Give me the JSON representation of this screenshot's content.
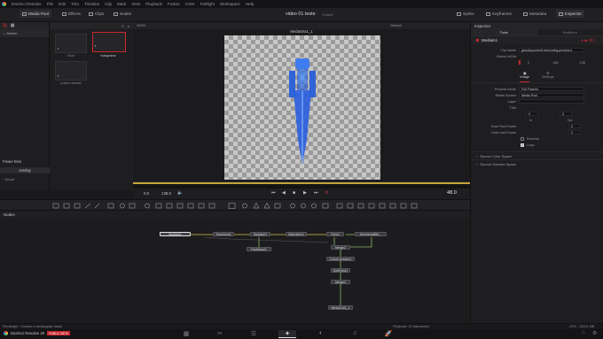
{
  "menubar": {
    "items": [
      "DaVinci Resolve",
      "File",
      "Edit",
      "Trim",
      "Timeline",
      "Clip",
      "Mark",
      "View",
      "Playback",
      "Fusion",
      "Color",
      "Fairlight",
      "Workspace",
      "Help"
    ]
  },
  "toolbar": {
    "media_pool": "Media Pool",
    "effects": "Effects",
    "clips": "Clips",
    "nodes": "Nodes",
    "project_title": "video 01 teste",
    "edited": "Edited",
    "spline": "Spline",
    "keyframes": "Keyframes",
    "metadata": "Metadata",
    "inspector": "Inspector"
  },
  "mediapool": {
    "master": "Master",
    "clips": [
      {
        "label": "Fluid",
        "selected": false
      },
      {
        "label": "holograma",
        "selected": true
      },
      {
        "label": "prata-e-bestial",
        "selected": false
      }
    ],
    "power_bins": "Power Bins",
    "overlay": "overlay",
    "smart_bins": "Smart"
  },
  "viewer": {
    "zoom": "200%",
    "fit": "Default",
    "clip_name": "MediaOut1_1",
    "current_frame": "0.0",
    "end_frame": "138.0",
    "timecode": "48.0"
  },
  "inspector": {
    "title": "Inspector",
    "tab_tools": "Tools",
    "tab_modifiers": "Modifiers",
    "node_name": "MediaIn1",
    "clip_name_label": "Clip Name",
    "clip_name_value": "giorclicyourself-removebg-preview.s",
    "global_inout_label": "Global In/Out",
    "global_in": "0",
    "global_mid": "138",
    "global_out": "138",
    "sub_tab_image": "Image",
    "sub_tab_settings": "Settings",
    "process_mode_label": "Process Mode",
    "process_mode_value": "Full Frames",
    "media_source_label": "Media Source",
    "media_source_value": "Media Pool",
    "layer_label": "Layer",
    "trim_label": "Trim",
    "trim_in": "0",
    "trim_out": "0",
    "in_label": "In",
    "out_label": "Out",
    "hold_first_label": "Hold First Frame",
    "hold_first_value": "0",
    "hold_last_label": "Hold Last Frame",
    "hold_last_value": "0",
    "reverse_label": "Reverse",
    "loop_label": "Loop",
    "source_color_space": "Source Color Space",
    "source_gamma_space": "Source Gamma Space"
  },
  "nodes": {
    "title": "Nodes",
    "items": [
      "MediaIn1",
      "Transform1",
      "Displace1",
      "Saturation1",
      "Glow1",
      "DirectionalBlu...",
      "FastNoise1",
      "Merge2",
      "ColorCorrector1",
      "SoftGlow1",
      "Merge1",
      "MediaOut1_1"
    ]
  },
  "statusbar": {
    "message": "Rectangle : Creates a rectangular mask",
    "playback": "Playback: 22 frames/sec",
    "memory": "20% - 19221 MB",
    "app": "DaVinci Resolve 20",
    "badge": "PUBLIC BETA"
  }
}
